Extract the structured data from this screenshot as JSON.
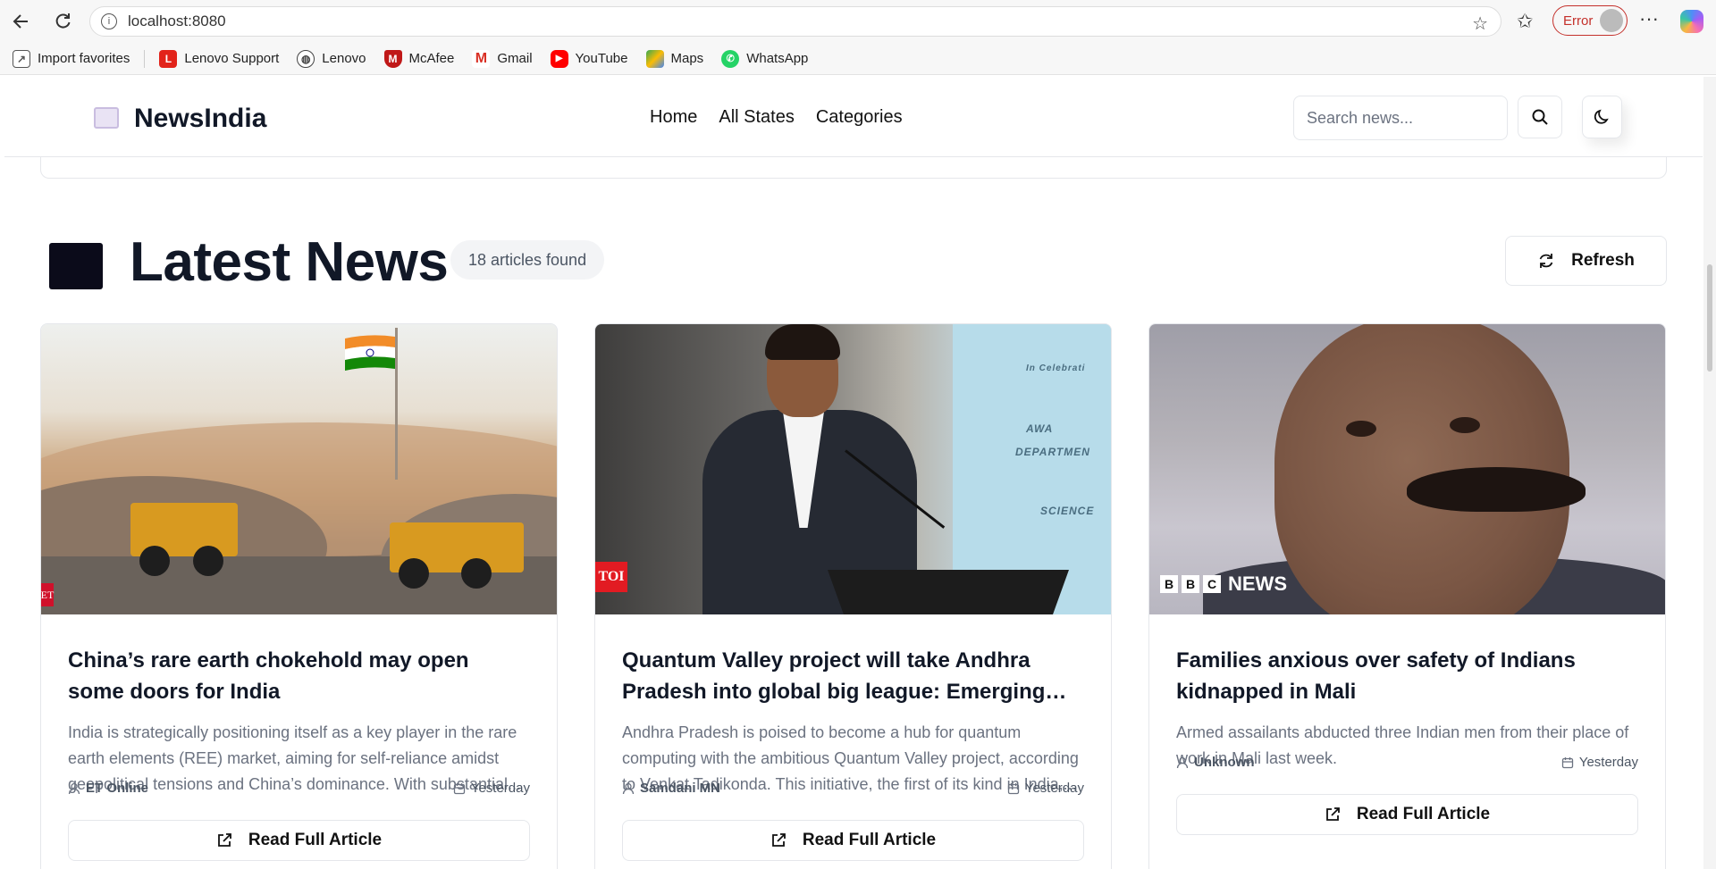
{
  "browser": {
    "url": "localhost:8080",
    "error_label": "Error",
    "bookmarks": [
      {
        "label": "Import favorites",
        "icon": "import-icon"
      },
      {
        "label": "Lenovo Support",
        "icon": "lenovo-support-icon"
      },
      {
        "label": "Lenovo",
        "icon": "globe-icon"
      },
      {
        "label": "McAfee",
        "icon": "mcafee-icon"
      },
      {
        "label": "Gmail",
        "icon": "gmail-icon"
      },
      {
        "label": "YouTube",
        "icon": "youtube-icon"
      },
      {
        "label": "Maps",
        "icon": "maps-icon"
      },
      {
        "label": "WhatsApp",
        "icon": "whatsapp-icon"
      }
    ]
  },
  "header": {
    "logo_text": "NewsIndia",
    "nav": [
      "Home",
      "All States",
      "Categories"
    ],
    "search_placeholder": "Search news..."
  },
  "section": {
    "title": "Latest News",
    "count_text": "18 articles found",
    "refresh_label": "Refresh"
  },
  "articles": [
    {
      "title": "China’s rare earth chokehold may open some doors for India",
      "description": "India is strategically positioning itself as a key player in the rare earth elements (REE) market, aiming for self-reliance amidst geopolitical tensions and China’s dominance. With substantial...",
      "author": "ET Online",
      "date": "Yesterday",
      "source_tag": "ET",
      "read_label": "Read Full Article"
    },
    {
      "title": "Quantum Valley project will take Andhra Pradesh into global big league: Emerging tech...",
      "description": "Andhra Pradesh is poised to become a hub for quantum computing with the ambitious Quantum Valley project, according to Venkat Tadikonda. This initiative, the first of its kind in India,...",
      "author": "Samdani MN",
      "date": "Yesterday",
      "source_tag": "TOI",
      "read_label": "Read Full Article"
    },
    {
      "title": "Families anxious over safety of Indians kidnapped in Mali",
      "description": "Armed assailants abducted three Indian men from their place of work in Mali last week.",
      "author": "Unknown",
      "date": "Yesterday",
      "source_tag": "NEWS",
      "read_label": "Read Full Article"
    }
  ],
  "colors": {
    "text_primary": "#111827",
    "text_muted": "#6b7280",
    "border": "#e5e7eb",
    "error": "#c4302b"
  }
}
